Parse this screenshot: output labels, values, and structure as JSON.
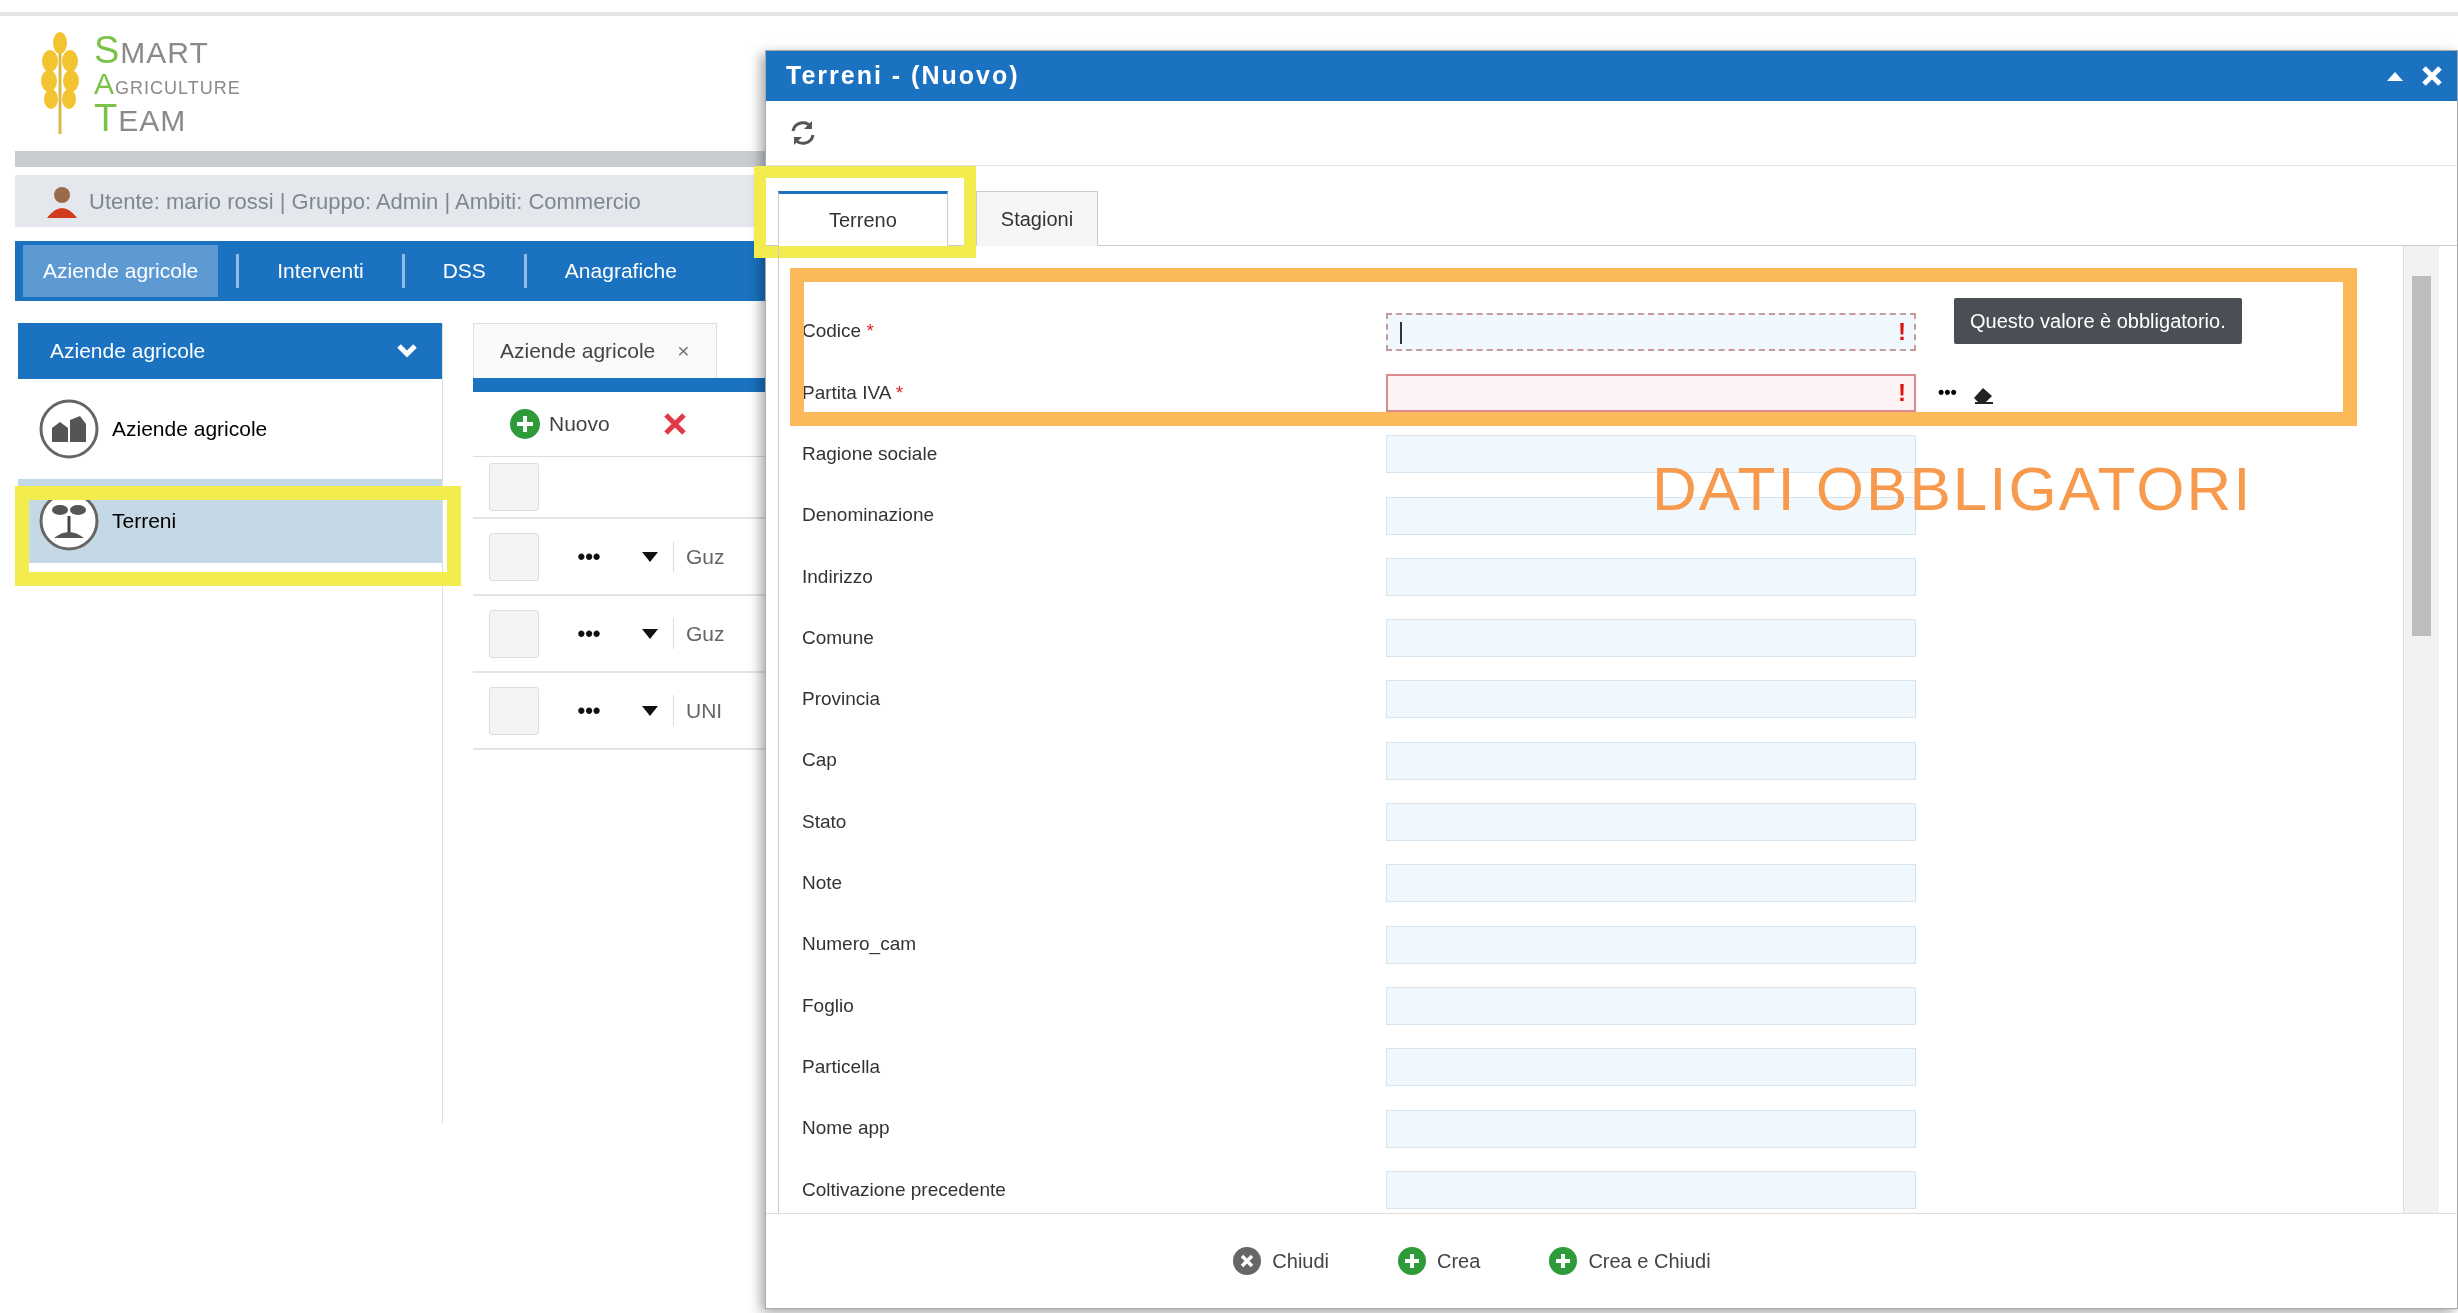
{
  "logo": {
    "lines": [
      {
        "initial": "S",
        "rest": "MART"
      },
      {
        "initial": "A",
        "rest": "GRICULTURE"
      },
      {
        "initial": "T",
        "rest": "EAM"
      }
    ]
  },
  "user_bar": {
    "text": "Utente: mario rossi | Gruppo: Admin | Ambiti: Commercio"
  },
  "nav": [
    {
      "label": "Aziende agricole",
      "selected": true
    },
    {
      "label": "Interventi",
      "selected": false
    },
    {
      "label": "DSS",
      "selected": false
    },
    {
      "label": "Anagrafiche",
      "selected": false
    }
  ],
  "sidebar": {
    "title": "Aziende agricole",
    "items": [
      {
        "label": "Aziende agricole",
        "kind": "farm",
        "selected": false
      },
      {
        "label": "Terreni",
        "kind": "sprout",
        "selected": true
      }
    ]
  },
  "main": {
    "tab": {
      "label": "Aziende agricole",
      "close": "×"
    },
    "toolbar": [
      {
        "kind": "add",
        "label": "Nuovo"
      },
      {
        "kind": "delete"
      }
    ],
    "header_checked": false,
    "rows": [
      {
        "checked": false,
        "menu": "•••",
        "cell": "Guz"
      },
      {
        "checked": false,
        "menu": "•••",
        "cell": "Guz"
      },
      {
        "checked": false,
        "menu": "•••",
        "cell": "UNI"
      }
    ]
  },
  "dialog": {
    "title": "Terreni - (Nuovo)",
    "tabs": [
      {
        "label": "Terreno",
        "selected": true
      },
      {
        "label": "Stagioni",
        "selected": false
      }
    ],
    "fields": [
      {
        "label": "Codice",
        "required_mark": "*",
        "invalid": true,
        "focused": true,
        "error_mark": "!",
        "tooltip": "Questo valore è obbligatorio."
      },
      {
        "label": "Partita IVA",
        "required_mark": "*",
        "invalid": true,
        "focused": false,
        "error_mark": "!",
        "lookup": "•••",
        "clear_button": true
      },
      {
        "label": "Ragione sociale",
        "invalid": false,
        "focused": false
      },
      {
        "label": "Denominazione",
        "invalid": false,
        "focused": false
      },
      {
        "label": "Indirizzo",
        "invalid": false,
        "focused": false
      },
      {
        "label": "Comune",
        "invalid": false,
        "focused": false
      },
      {
        "label": "Provincia",
        "invalid": false,
        "focused": false
      },
      {
        "label": "Cap",
        "invalid": false,
        "focused": false
      },
      {
        "label": "Stato",
        "invalid": false,
        "focused": false
      },
      {
        "label": "Note",
        "invalid": false,
        "focused": false
      },
      {
        "label": "Numero_cam",
        "invalid": false,
        "focused": false
      },
      {
        "label": "Foglio",
        "invalid": false,
        "focused": false
      },
      {
        "label": "Particella",
        "invalid": false,
        "focused": false
      },
      {
        "label": "Nome app",
        "invalid": false,
        "focused": false
      },
      {
        "label": "Coltivazione precedente",
        "invalid": false,
        "focused": false
      }
    ],
    "buttons": [
      {
        "kind": "close",
        "label": "Chiudi"
      },
      {
        "kind": "add",
        "label": "Crea"
      },
      {
        "kind": "add",
        "label": "Crea e Chiudi"
      }
    ]
  },
  "annotation": {
    "text": "DATI OBBLIGATORI"
  }
}
